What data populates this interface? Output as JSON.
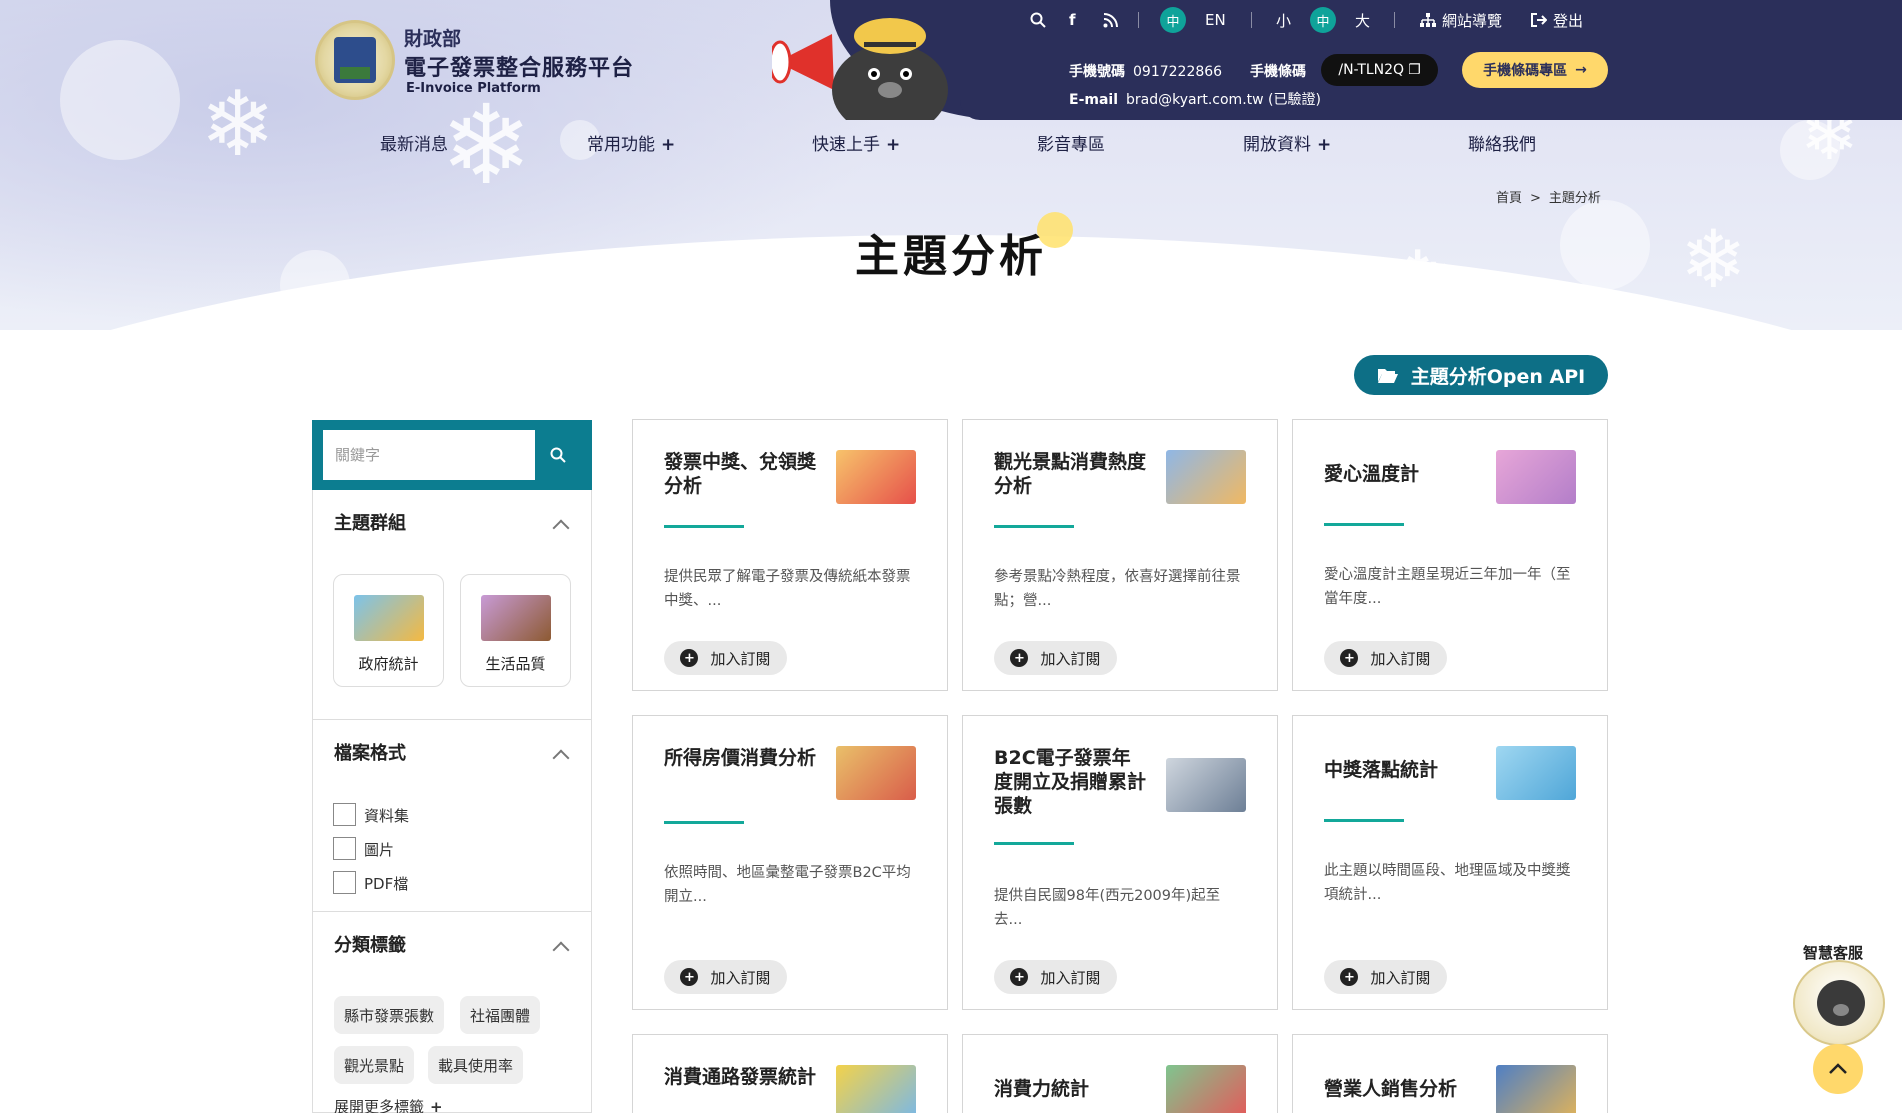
{
  "site": {
    "dept": "財政部",
    "title": "電子發票整合服務平台",
    "title_en": "E-Invoice Platform"
  },
  "toolbar": {
    "lang_zh": "中",
    "lang_en": "EN",
    "font_small": "小",
    "font_mid": "中",
    "font_large": "大",
    "sitemap": "網站導覽",
    "logout": "登出"
  },
  "user": {
    "phone_label": "手機號碼",
    "phone": "0917222866",
    "barcode_label": "手機條碼",
    "barcode": "/N-TLN2Q",
    "email_label": "E-mail",
    "email": "brad@kyart.com.tw (已驗證)",
    "barcode_zone": "手機條碼專區"
  },
  "nav": [
    {
      "label": "最新消息",
      "plus": ""
    },
    {
      "label": "常用功能",
      "plus": "+"
    },
    {
      "label": "快速上手",
      "plus": "+"
    },
    {
      "label": "影音專區",
      "plus": ""
    },
    {
      "label": "開放資料",
      "plus": "+"
    },
    {
      "label": "聯絡我們",
      "plus": ""
    }
  ],
  "breadcrumb": {
    "home": "首頁",
    "sep": ">",
    "current": "主題分析"
  },
  "page_title": "主題分析",
  "api_button": "主題分析Open API",
  "sidebar": {
    "search_placeholder": "關鍵字",
    "group_title": "主題群組",
    "groups": [
      {
        "label": "政府統計",
        "icon": "gov-stats-icon"
      },
      {
        "label": "生活品質",
        "icon": "life-quality-icon"
      }
    ],
    "format_title": "檔案格式",
    "formats": [
      "資料集",
      "圖片",
      "PDF檔"
    ],
    "tag_title": "分類標籤",
    "tags": [
      "縣市發票張數",
      "社福團體",
      "觀光景點",
      "載具使用率"
    ],
    "more": "展開更多標籤"
  },
  "subscribe_label": "加入訂閱",
  "cards": [
    {
      "title": "發票中獎、兌領獎分析",
      "desc": "提供民眾了解電子發票及傳統紙本發票中獎、...",
      "img_color": "#f7c36b"
    },
    {
      "title": "觀光景點消費熱度分析",
      "desc": "參考景點冷熱程度，依喜好選擇前往景點；營...",
      "img_color": "#8fb7e6"
    },
    {
      "title": "愛心溫度計",
      "desc": "愛心溫度計主題呈現近三年加一年（至當年度...",
      "img_color": "#e7a6d8"
    },
    {
      "title": "所得房價消費分析",
      "desc": "依照時間、地區彙整電子發票B2C平均開立...",
      "img_color": "#e9c06a"
    },
    {
      "title": "B2C電子發票年度開立及捐贈累計張數",
      "desc": "提供自民國98年(西元2009年)起至去...",
      "img_color": "#cfd6de"
    },
    {
      "title": "中獎落點統計",
      "desc": "此主題以時間區段、地理區域及中獎獎項統計...",
      "img_color": "#9fd7f1"
    },
    {
      "title": "消費通路發票統計",
      "desc": "",
      "img_color": "#f3d24a"
    },
    {
      "title": "消費力統計",
      "desc": "",
      "img_color": "#7fc58f"
    },
    {
      "title": "營業人銷售分析",
      "desc": "",
      "img_color": "#4f7fc4"
    }
  ],
  "bot_label": "智慧客服"
}
